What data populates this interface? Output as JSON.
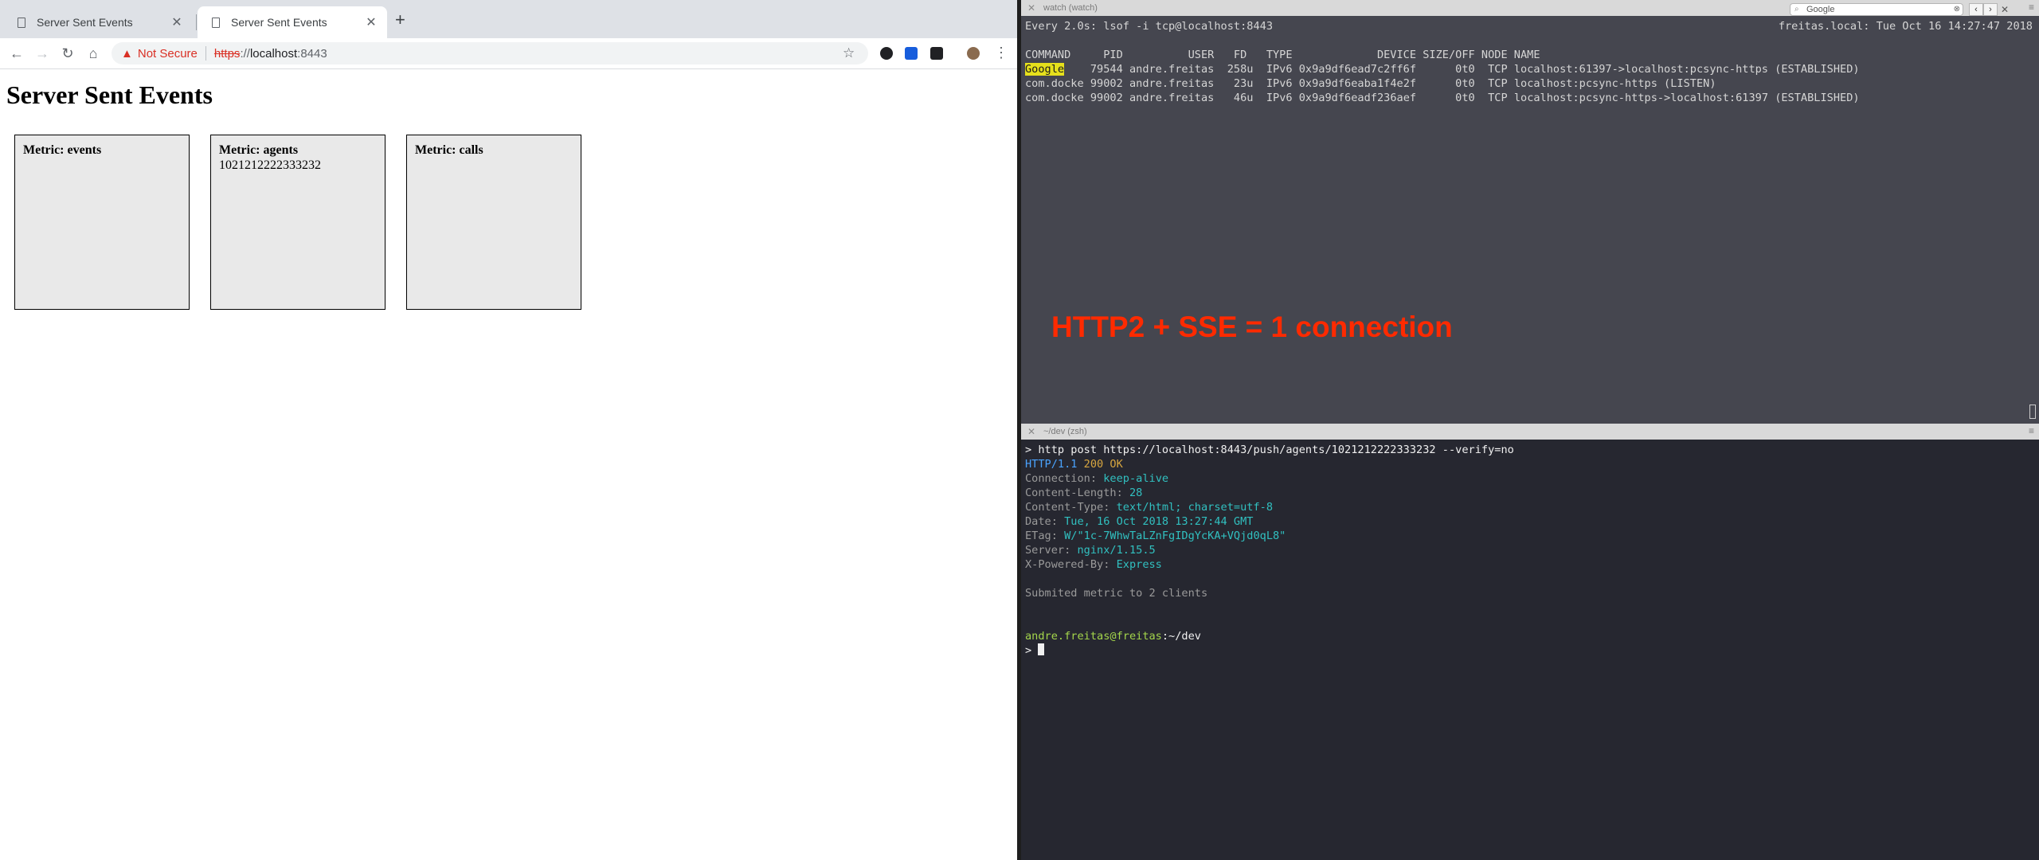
{
  "browser": {
    "tabs": [
      {
        "title": "Server Sent Events",
        "active": false
      },
      {
        "title": "Server Sent Events",
        "active": true
      }
    ],
    "new_tab": "+",
    "security_label": "Not Secure",
    "url_scheme": "https",
    "url_sep": "://",
    "url_host": "localhost",
    "url_port": ":8443",
    "page_title": "Server Sent Events",
    "metrics": [
      {
        "title": "Metric: events",
        "value": ""
      },
      {
        "title": "Metric: agents",
        "value": "1021212222333232"
      },
      {
        "title": "Metric: calls",
        "value": ""
      }
    ]
  },
  "terminal": {
    "top_pane": {
      "title": "watch (watch)",
      "search_value": "Google",
      "header_left": "Every 2.0s: lsof -i tcp@localhost:8443",
      "header_right": "freitas.local: Tue Oct 16 14:27:47 2018",
      "columns_line": "COMMAND     PID          USER   FD   TYPE             DEVICE SIZE/OFF NODE NAME",
      "rows": [
        {
          "cmd": "Google",
          "rest": "    79544 andre.freitas  258u  IPv6 0x9a9df6ead7c2ff6f      0t0  TCP localhost:61397->localhost:pcsync-https (ESTABLISHED)"
        },
        {
          "cmd": "com.docke",
          "rest": " 99002 andre.freitas   23u  IPv6 0x9a9df6eaba1f4e2f      0t0  TCP localhost:pcsync-https (LISTEN)"
        },
        {
          "cmd": "com.docke",
          "rest": " 99002 andre.freitas   46u  IPv6 0x9a9df6eadf236aef      0t0  TCP localhost:pcsync-https->localhost:61397 (ESTABLISHED)"
        }
      ],
      "overlay": "HTTP2 + SSE = 1 connection"
    },
    "bottom_pane": {
      "title": "~/dev (zsh)",
      "command": "> http post https://localhost:8443/push/agents/1021212222333232 --verify=no",
      "status": {
        "proto": "HTTP",
        "ver": "/1.1 ",
        "code": "200 ",
        "text": "OK"
      },
      "headers": [
        {
          "key": "Connection: ",
          "value": "keep-alive"
        },
        {
          "key": "Content-Length: ",
          "value": "28"
        },
        {
          "key": "Content-Type: ",
          "value": "text/html; charset=utf-8"
        },
        {
          "key": "Date: ",
          "value": "Tue, 16 Oct 2018 13:27:44 GMT"
        },
        {
          "key": "ETag: ",
          "value": "W/\"1c-7WhwTaLZnFgIDgYcKA+VQjd0qL8\""
        },
        {
          "key": "Server: ",
          "value": "nginx/1.15.5"
        },
        {
          "key": "X-Powered-By: ",
          "value": "Express"
        }
      ],
      "body": "Submited metric to 2 clients",
      "prompt_user": "andre.freitas@freitas",
      "prompt_path": ":~/dev",
      "prompt_symbol": "> "
    }
  }
}
